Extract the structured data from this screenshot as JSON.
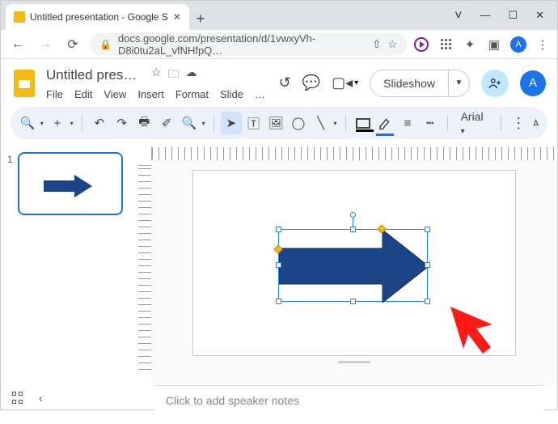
{
  "browser": {
    "tab_title": "Untitled presentation - Google S",
    "url": "docs.google.com/presentation/d/1vwxyVh-D8i0tu2aL_vfNHfpQ…",
    "account_initial": "A"
  },
  "header": {
    "doc_title": "Untitled prese…",
    "menus": [
      "File",
      "Edit",
      "View",
      "Insert",
      "Format",
      "Slide",
      "…"
    ],
    "slideshow_label": "Slideshow",
    "avatar_initial": "A"
  },
  "toolbar": {
    "font": "Arial"
  },
  "thumbs": {
    "slide1_num": "1"
  },
  "notes": {
    "placeholder": "Click to add speaker notes"
  },
  "shape": {
    "fill": "#1c4587",
    "selection_border": "#2684fc"
  }
}
